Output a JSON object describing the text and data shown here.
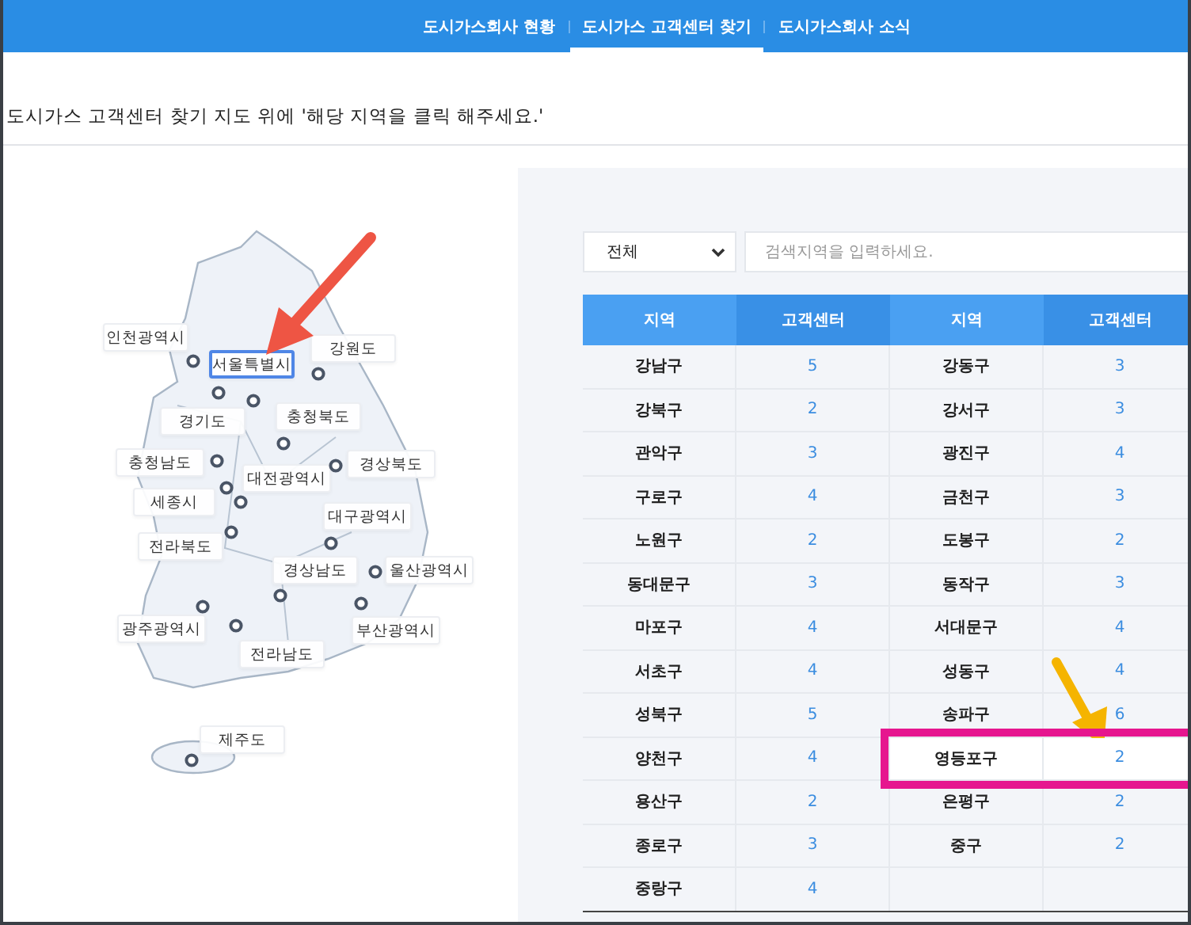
{
  "nav": {
    "tabs": [
      {
        "label": "도시가스회사 현황",
        "selected": false
      },
      {
        "label": "도시가스 고객센터 찾기",
        "selected": true
      },
      {
        "label": "도시가스회사 소식",
        "selected": false
      }
    ]
  },
  "instruction": "도시가스 고객센터 찾기 지도 위에 '해당 지역을 클릭 해주세요.'",
  "map": {
    "regions": [
      {
        "label": "인천광역시",
        "selected": false
      },
      {
        "label": "서울특별시",
        "selected": true
      },
      {
        "label": "강원도",
        "selected": false
      },
      {
        "label": "경기도",
        "selected": false
      },
      {
        "label": "충청북도",
        "selected": false
      },
      {
        "label": "충청남도",
        "selected": false
      },
      {
        "label": "대전광역시",
        "selected": false
      },
      {
        "label": "경상북도",
        "selected": false
      },
      {
        "label": "세종시",
        "selected": false
      },
      {
        "label": "대구광역시",
        "selected": false
      },
      {
        "label": "전라북도",
        "selected": false
      },
      {
        "label": "경상남도",
        "selected": false
      },
      {
        "label": "울산광역시",
        "selected": false
      },
      {
        "label": "광주광역시",
        "selected": false
      },
      {
        "label": "부산광역시",
        "selected": false
      },
      {
        "label": "전라남도",
        "selected": false
      },
      {
        "label": "제주도",
        "selected": false
      }
    ]
  },
  "search": {
    "select": "전체",
    "placeholder": "검색지역을 입력하세요."
  },
  "table": {
    "columns": [
      "지역",
      "고객센터",
      "지역",
      "고객센터"
    ],
    "rows": [
      {
        "districts": [
          {
            "name": "강남구",
            "count": "5",
            "highlighted": false
          },
          {
            "name": "강동구",
            "count": "3",
            "highlighted": false
          }
        ]
      },
      {
        "districts": [
          {
            "name": "강북구",
            "count": "2",
            "highlighted": false
          },
          {
            "name": "강서구",
            "count": "3",
            "highlighted": false
          }
        ]
      },
      {
        "districts": [
          {
            "name": "관악구",
            "count": "3",
            "highlighted": false
          },
          {
            "name": "광진구",
            "count": "4",
            "highlighted": false
          }
        ]
      },
      {
        "districts": [
          {
            "name": "구로구",
            "count": "4",
            "highlighted": false
          },
          {
            "name": "금천구",
            "count": "3",
            "highlighted": false
          }
        ]
      },
      {
        "districts": [
          {
            "name": "노원구",
            "count": "2",
            "highlighted": false
          },
          {
            "name": "도봉구",
            "count": "2",
            "highlighted": false
          }
        ]
      },
      {
        "districts": [
          {
            "name": "동대문구",
            "count": "3",
            "highlighted": false
          },
          {
            "name": "동작구",
            "count": "3",
            "highlighted": false
          }
        ]
      },
      {
        "districts": [
          {
            "name": "마포구",
            "count": "4",
            "highlighted": false
          },
          {
            "name": "서대문구",
            "count": "4",
            "highlighted": false
          }
        ]
      },
      {
        "districts": [
          {
            "name": "서초구",
            "count": "4",
            "highlighted": false
          },
          {
            "name": "성동구",
            "count": "4",
            "highlighted": false
          }
        ]
      },
      {
        "districts": [
          {
            "name": "성북구",
            "count": "5",
            "highlighted": false
          },
          {
            "name": "송파구",
            "count": "6",
            "highlighted": false
          }
        ]
      },
      {
        "districts": [
          {
            "name": "양천구",
            "count": "4",
            "highlighted": false
          },
          {
            "name": "영등포구",
            "count": "2",
            "highlighted": true
          }
        ]
      },
      {
        "districts": [
          {
            "name": "용산구",
            "count": "2",
            "highlighted": false
          },
          {
            "name": "은평구",
            "count": "2",
            "highlighted": false
          }
        ]
      },
      {
        "districts": [
          {
            "name": "종로구",
            "count": "3",
            "highlighted": false
          },
          {
            "name": "중구",
            "count": "2",
            "highlighted": false
          }
        ]
      },
      {
        "districts": [
          {
            "name": "중랑구",
            "count": "4",
            "highlighted": false
          }
        ]
      }
    ]
  }
}
